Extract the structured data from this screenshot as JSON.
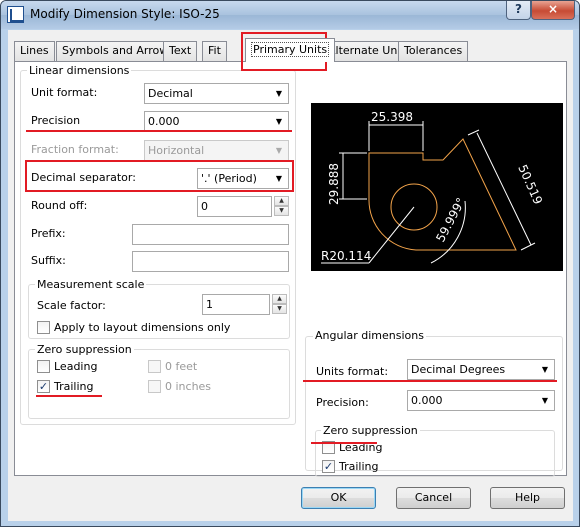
{
  "window": {
    "title": "Modify Dimension Style: ISO-25",
    "help_glyph": "?",
    "close_glyph": "×"
  },
  "tabs": [
    "Lines",
    "Symbols and Arrows",
    "Text",
    "Fit",
    "Primary Units",
    "Alternate Units",
    "Tolerances"
  ],
  "linear": {
    "group_title": "Linear dimensions",
    "unit_format_label": "Unit format:",
    "unit_format_value": "Decimal",
    "precision_label": "Precision",
    "precision_value": "0.000",
    "fraction_format_label": "Fraction format:",
    "fraction_format_value": "Horizontal",
    "decimal_separator_label": "Decimal separator:",
    "decimal_separator_value": "'.' (Period)",
    "round_off_label": "Round off:",
    "round_off_value": "0",
    "prefix_label": "Prefix:",
    "suffix_label": "Suffix:"
  },
  "measurement": {
    "group_title": "Measurement scale",
    "scale_factor_label": "Scale factor:",
    "scale_factor_value": "1",
    "layout_only_label": "Apply to layout dimensions only",
    "layout_only_checked": false
  },
  "linear_zero": {
    "group_title": "Zero suppression",
    "leading_label": "Leading",
    "leading_checked": false,
    "trailing_label": "Trailing",
    "trailing_checked": true,
    "feet_label": "0 feet",
    "inches_label": "0 inches"
  },
  "angular": {
    "group_title": "Angular dimensions",
    "units_format_label": "Units format:",
    "units_format_value": "Decimal Degrees",
    "precision_label": "Precision:",
    "precision_value": "0.000"
  },
  "angular_zero": {
    "group_title": "Zero suppression",
    "leading_label": "Leading",
    "leading_checked": false,
    "trailing_label": "Trailing",
    "trailing_checked": true
  },
  "preview": {
    "dim_top": "25.398",
    "dim_left": "29.888",
    "dim_right": "50.519",
    "dim_angle": "59.999°",
    "dim_radius": "R20.114",
    "colors": {
      "background": "#000000",
      "geometry": "#f2a34a",
      "dimension": "#ffffff"
    }
  },
  "buttons": {
    "ok": "OK",
    "cancel": "Cancel",
    "help": "Help"
  },
  "highlight_color": "#e21b24"
}
